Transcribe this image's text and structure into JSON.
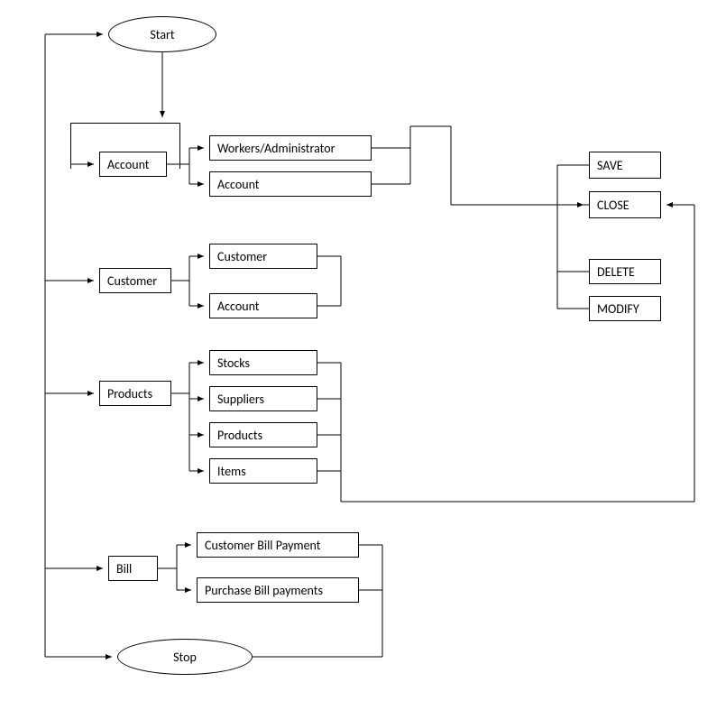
{
  "terminals": {
    "start": "Start",
    "stop": "Stop"
  },
  "menu": {
    "account": {
      "label": "Account",
      "children": [
        "Workers/Administrator",
        "Account"
      ]
    },
    "customer": {
      "label": "Customer",
      "children": [
        "Customer",
        "Account"
      ]
    },
    "products": {
      "label": "Products",
      "children": [
        "Stocks",
        "Suppliers",
        "Products",
        "Items"
      ]
    },
    "bill": {
      "label": "Bill",
      "children": [
        "Customer Bill Payment",
        "Purchase Bill payments"
      ]
    }
  },
  "actions": [
    "SAVE",
    "CLOSE",
    "DELETE",
    "MODIFY"
  ]
}
